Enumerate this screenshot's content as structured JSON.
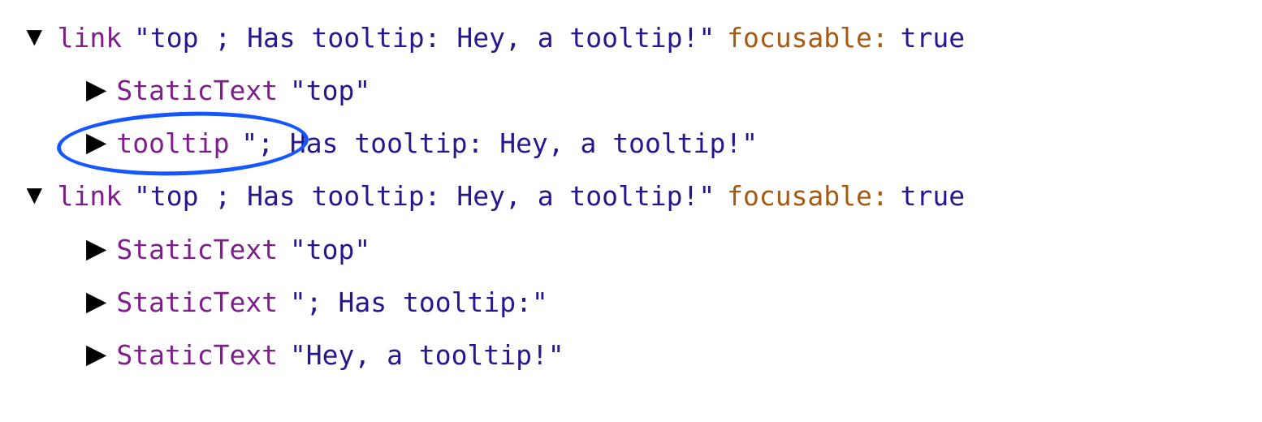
{
  "tree": [
    {
      "expanded": true,
      "indent": 0,
      "role": "link",
      "text": "\"top ; Has tooltip: Hey, a tooltip!\"",
      "attribute": "focusable",
      "value": "true"
    },
    {
      "expanded": false,
      "indent": 1,
      "role": "StaticText",
      "text": "\"top\""
    },
    {
      "expanded": false,
      "indent": 1,
      "role": "tooltip",
      "text": "\"; Has tooltip: Hey, a tooltip!\"",
      "annotated": true
    },
    {
      "expanded": true,
      "indent": 0,
      "role": "link",
      "text": "\"top ; Has tooltip: Hey, a tooltip!\"",
      "attribute": "focusable",
      "value": "true"
    },
    {
      "expanded": false,
      "indent": 1,
      "role": "StaticText",
      "text": "\"top\""
    },
    {
      "expanded": false,
      "indent": 1,
      "role": "StaticText",
      "text": "\"; Has tooltip:\""
    },
    {
      "expanded": false,
      "indent": 1,
      "role": "StaticText",
      "text": "\"Hey, a tooltip!\""
    }
  ],
  "glyphs": {
    "expanded": "▼",
    "collapsed": "▶"
  },
  "colon": ":"
}
